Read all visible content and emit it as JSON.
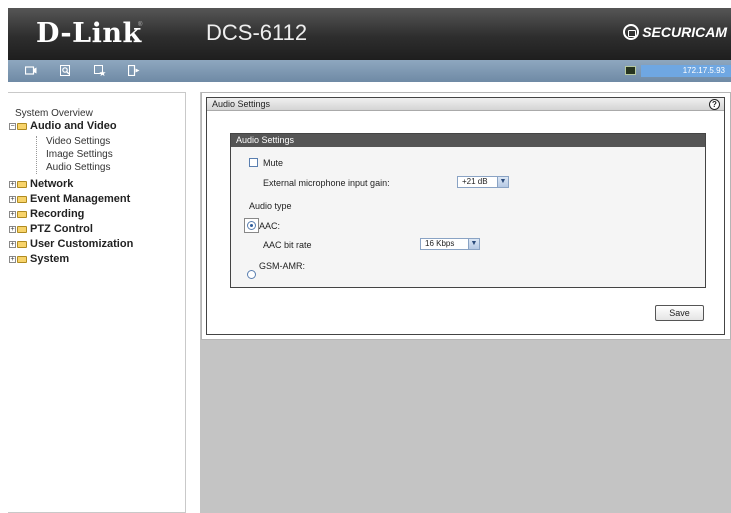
{
  "header": {
    "brand": "D-Link",
    "model": "DCS-6112",
    "logo_text": "SECURICAM"
  },
  "toolbar": {
    "icons": [
      "camera-icon",
      "search-icon",
      "favorite-icon",
      "logout-icon"
    ],
    "ip_address": "172.17.5.93"
  },
  "sidebar": {
    "overview_label": "System Overview",
    "groups": [
      {
        "label": "Audio and Video",
        "expanded": true,
        "items": [
          "Video Settings",
          "Image Settings",
          "Audio Settings"
        ]
      },
      {
        "label": "Network",
        "expanded": false
      },
      {
        "label": "Event Management",
        "expanded": false
      },
      {
        "label": "Recording",
        "expanded": false
      },
      {
        "label": "PTZ Control",
        "expanded": false
      },
      {
        "label": "User Customization",
        "expanded": false
      },
      {
        "label": "System",
        "expanded": false
      }
    ]
  },
  "page": {
    "title": "Audio Settings",
    "help_icon": "?",
    "section_title": "Audio Settings",
    "mute_label": "Mute",
    "mute_checked": false,
    "mic_gain_label": "External microphone input gain:",
    "mic_gain_value": "+21 dB",
    "audio_type_label": "Audio type",
    "aac_label": "AAC:",
    "aac_selected": true,
    "aac_bitrate_label": "AAC bit rate",
    "aac_bitrate_value": "16 Kbps",
    "gsm_label": "GSM-AMR:",
    "save_label": "Save"
  },
  "colors": {
    "header_bg": "#2e2e2e",
    "toolbar_bg": "#7f98b2",
    "ip_box_bg": "#6fa7e2",
    "content_bg": "#c4c4c4",
    "fieldset_title_bg": "#555555"
  }
}
